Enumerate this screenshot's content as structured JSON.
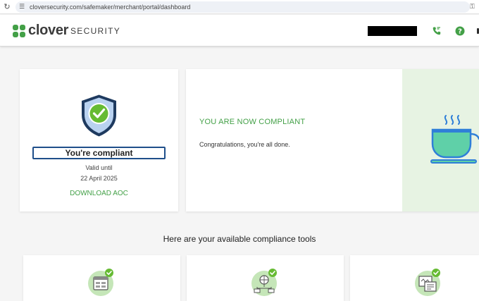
{
  "browser": {
    "url": "cloversecurity.com/safemaker/merchant/portal/dashboard"
  },
  "header": {
    "logo_word": "clover",
    "logo_sub": "SECURITY"
  },
  "status_card": {
    "status_label": "You're compliant",
    "valid_label": "Valid until",
    "valid_date": "22 April 2025",
    "download_label": "DOWNLOAD AOC"
  },
  "congrats_card": {
    "heading": "YOU ARE NOW COMPLIANT",
    "text": "Congratulations, you're all done."
  },
  "tools": {
    "heading": "Here are your available compliance tools"
  },
  "colors": {
    "brand_green": "#43a047",
    "shield_blue": "#1f4f8a",
    "panel_green": "#e7f3e3"
  },
  "icons": [
    "reload-icon",
    "site-settings-icon",
    "key-icon",
    "clover-logo-icon",
    "phone-icon",
    "help-icon",
    "shield-check-icon",
    "coffee-cup-icon",
    "tool-questionnaire-icon",
    "tool-network-scan-icon",
    "tool-documents-icon"
  ]
}
